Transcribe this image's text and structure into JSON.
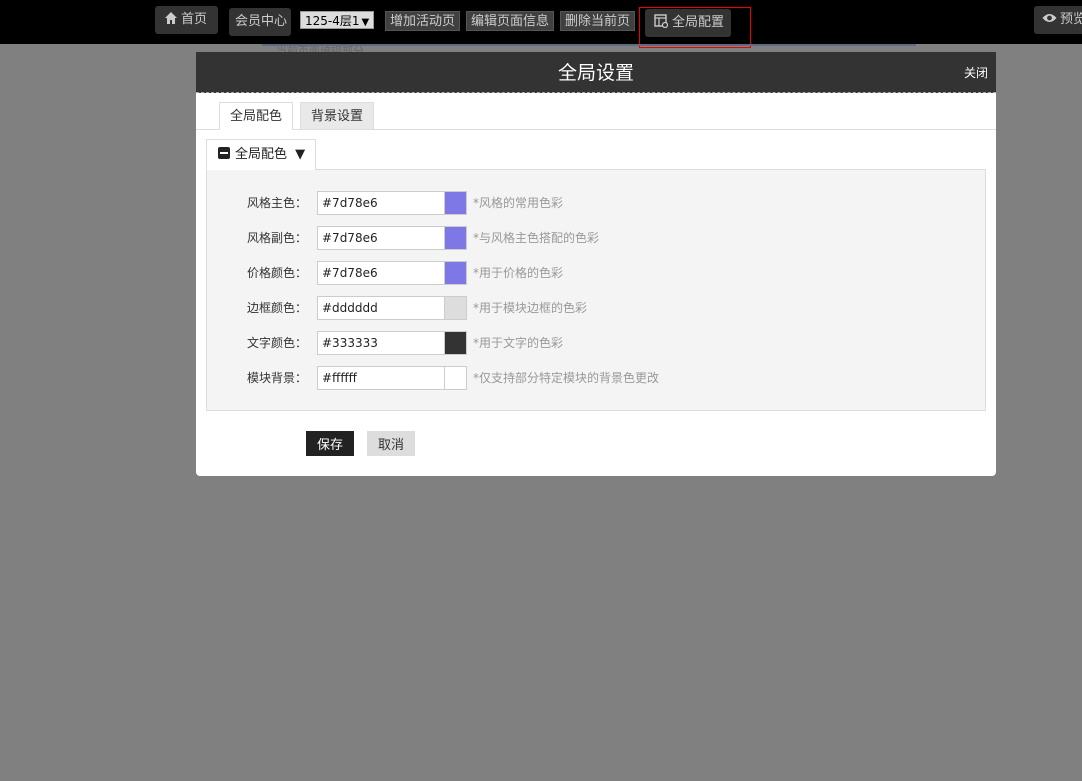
{
  "toolbar": {
    "home_label": "首页",
    "member_center": "会员中心",
    "page_select": "125-4层1",
    "add_page": "增加活动页",
    "edit_page": "编辑页面信息",
    "delete_page": "删除当前页",
    "global_config": "全局配置",
    "preview": "预览"
  },
  "background": {
    "partial_text": "当前页面编辑部分"
  },
  "modal": {
    "title": "全局设置",
    "close": "关闭",
    "tabs": [
      {
        "label": "全局配色",
        "active": true
      },
      {
        "label": "背景设置",
        "active": false
      }
    ],
    "section_title": "全局配色",
    "section_arrow": "▼",
    "rows": [
      {
        "label": "风格主色：",
        "value": "#7d78e6",
        "swatch": "#7d78e6",
        "hint": "*风格的常用色彩"
      },
      {
        "label": "风格副色：",
        "value": "#7d78e6",
        "swatch": "#7d78e6",
        "hint": "*与风格主色搭配的色彩"
      },
      {
        "label": "价格颜色：",
        "value": "#7d78e6",
        "swatch": "#7d78e6",
        "hint": "*用于价格的色彩"
      },
      {
        "label": "边框颜色：",
        "value": "#dddddd",
        "swatch": "#dddddd",
        "hint": "*用于模块边框的色彩"
      },
      {
        "label": "文字颜色：",
        "value": "#333333",
        "swatch": "#333333",
        "hint": "*用于文字的色彩"
      },
      {
        "label": "模块背景：",
        "value": "#ffffff",
        "swatch": "#ffffff",
        "hint": "*仅支持部分特定模块的背景色更改"
      }
    ],
    "save": "保存",
    "cancel": "取消"
  }
}
